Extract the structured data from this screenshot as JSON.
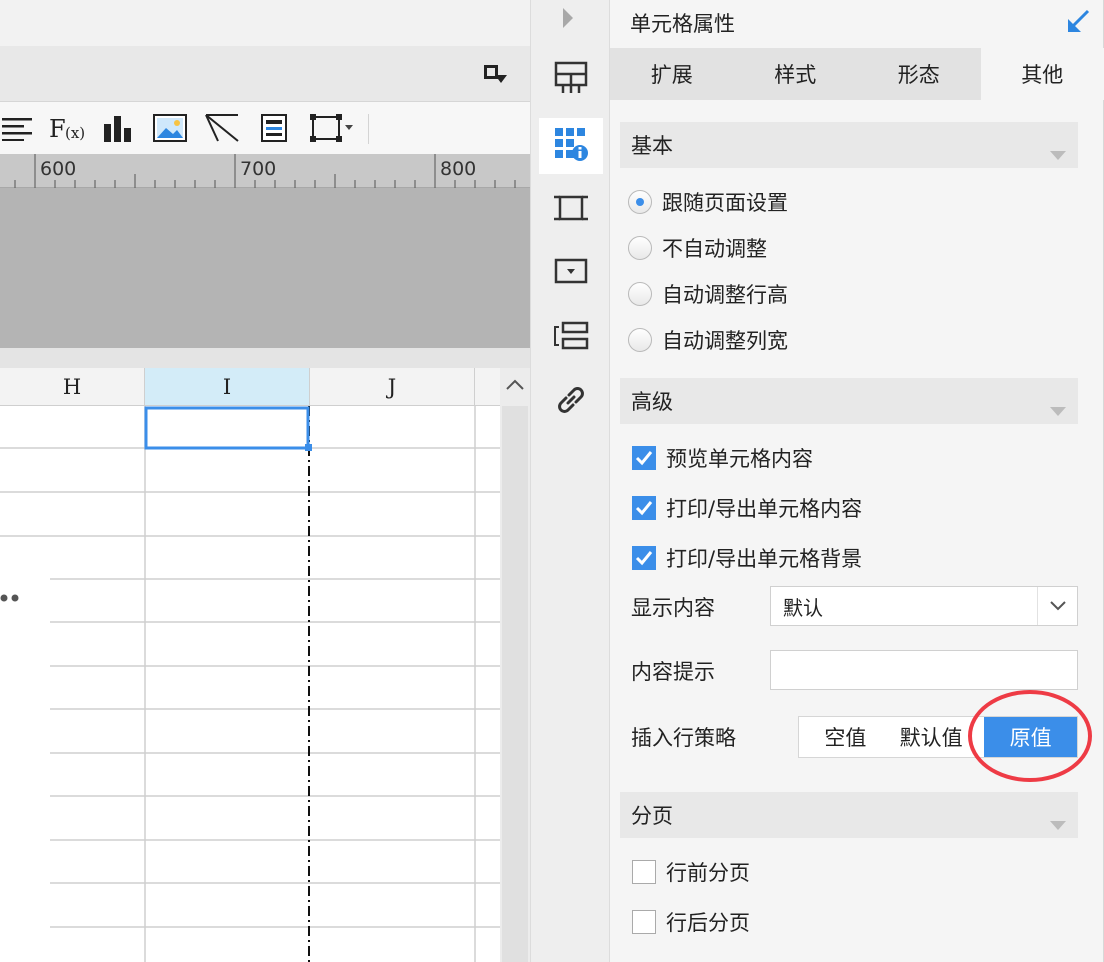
{
  "designer": {
    "ruler": {
      "ticks": [
        "600",
        "700",
        "800"
      ]
    },
    "columns": [
      {
        "label": "H",
        "selected": false
      },
      {
        "label": "I",
        "selected": true
      },
      {
        "label": "J",
        "selected": false
      }
    ]
  },
  "sidebar": {
    "items": [
      {
        "icon": "cell-expand-icon",
        "active": false
      },
      {
        "icon": "cell-attribute-icon",
        "active": true
      },
      {
        "icon": "border-frame-icon",
        "active": false
      },
      {
        "icon": "widget-icon",
        "active": false
      },
      {
        "icon": "condition-icon",
        "active": false
      },
      {
        "icon": "hyperlink-icon",
        "active": false
      }
    ]
  },
  "panel": {
    "title": "单元格属性",
    "tabs": [
      {
        "label": "扩展",
        "active": false
      },
      {
        "label": "样式",
        "active": false
      },
      {
        "label": "形态",
        "active": false
      },
      {
        "label": "其他",
        "active": true
      }
    ],
    "basic": {
      "title": "基本",
      "options": [
        {
          "label": "跟随页面设置",
          "checked": true
        },
        {
          "label": "不自动调整",
          "checked": false
        },
        {
          "label": "自动调整行高",
          "checked": false
        },
        {
          "label": "自动调整列宽",
          "checked": false
        }
      ]
    },
    "advanced": {
      "title": "高级",
      "checks": [
        {
          "label": "预览单元格内容",
          "checked": true
        },
        {
          "label": "打印/导出单元格内容",
          "checked": true
        },
        {
          "label": "打印/导出单元格背景",
          "checked": true
        }
      ],
      "display_label": "显示内容",
      "display_value": "默认",
      "tooltip_label": "内容提示",
      "tooltip_value": "",
      "insert_label": "插入行策略",
      "insert_options": [
        "空值",
        "默认值",
        "原值"
      ],
      "insert_selected": 2
    },
    "paging": {
      "title": "分页",
      "checks": [
        {
          "label": "行前分页",
          "checked": false
        },
        {
          "label": "行后分页",
          "checked": false
        }
      ]
    }
  },
  "colors": {
    "accent": "#3b8ee9",
    "highlight_circle": "#ee3b45",
    "selected_column": "#d3ecf8"
  }
}
